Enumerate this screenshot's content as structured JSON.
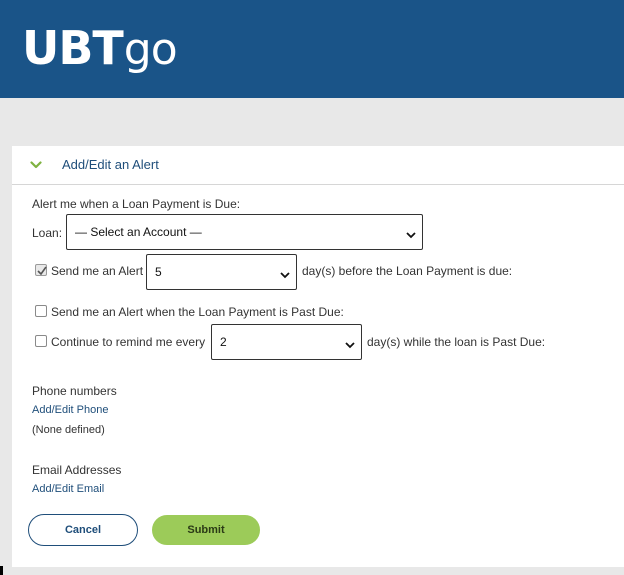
{
  "brand": {
    "logo_bold": "UBT",
    "logo_light": "go",
    "header_color": "#1a5488",
    "accent_green": "#9ccb59"
  },
  "panel": {
    "title": "Add/Edit an Alert",
    "chevron_icon": "chevron-down-icon"
  },
  "form": {
    "intro": "Alert me when a Loan Payment is Due:",
    "loan_label": "Loan:",
    "loan_selected": "— Select an Account —",
    "send_alert_label": "Send me an Alert",
    "send_alert_checked": true,
    "days_before_selected": "5",
    "days_before_suffix": "day(s) before the Loan Payment is due:",
    "past_due_label": "Send me an Alert when the Loan Payment is Past Due:",
    "past_due_checked": false,
    "remind_label": "Continue to remind me every",
    "remind_checked": false,
    "remind_selected": "2",
    "remind_suffix": "day(s) while the loan is Past Due:"
  },
  "phone": {
    "heading": "Phone numbers",
    "link": "Add/Edit Phone",
    "status": "(None defined)"
  },
  "email": {
    "heading": "Email Addresses",
    "link": "Add/Edit Email"
  },
  "buttons": {
    "cancel": "Cancel",
    "submit": "Submit"
  }
}
